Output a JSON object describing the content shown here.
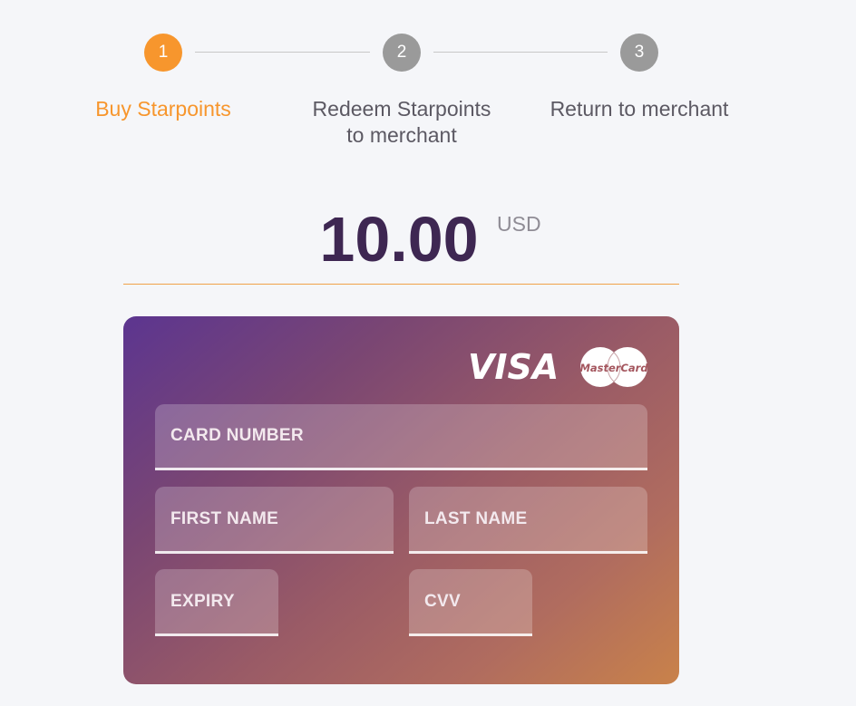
{
  "stepper": {
    "steps": [
      {
        "number": "1",
        "label_line1": "Buy Starpoints",
        "label_line2": "",
        "state": "active"
      },
      {
        "number": "2",
        "label_line1": "Redeem Starpoints",
        "label_line2": "to merchant",
        "state": "inactive"
      },
      {
        "number": "3",
        "label_line1": "Return to merchant",
        "label_line2": "",
        "state": "inactive"
      }
    ],
    "colors": {
      "active": "#f7962d",
      "inactive": "#9a9a9a"
    }
  },
  "amount": {
    "value": "10.00",
    "currency": "USD"
  },
  "card_form": {
    "brands": {
      "visa": "VISA",
      "mastercard": "MasterCard"
    },
    "fields": {
      "card_number": "CARD NUMBER",
      "first_name": "FIRST NAME",
      "last_name": "LAST NAME",
      "expiry": "EXPIRY",
      "cvv": "CVV"
    }
  }
}
